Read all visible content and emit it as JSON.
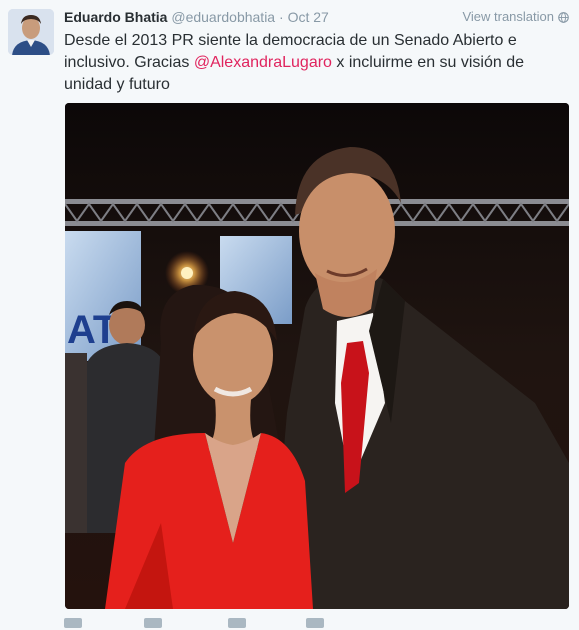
{
  "tweet": {
    "author": {
      "name": "Eduardo Bhatia",
      "handle": "@eduardobhatia"
    },
    "separator": "·",
    "date": "Oct 27",
    "translate_label": "View translation",
    "icons": {
      "globe": "globe-icon",
      "reply": "reply-icon",
      "retweet": "retweet-icon",
      "like": "like-icon",
      "more": "more-icon"
    },
    "text_before": "Desde el 2013 PR siente la democracia de un Senado Abierto e inclusivo. Gracias ",
    "mention": "@AlexandraLugaro",
    "text_after": " x incluirme en su visión de unidad y futuro",
    "colors": {
      "mention": "#e0245e",
      "name": "#292f33",
      "muted": "#8899a6"
    }
  }
}
